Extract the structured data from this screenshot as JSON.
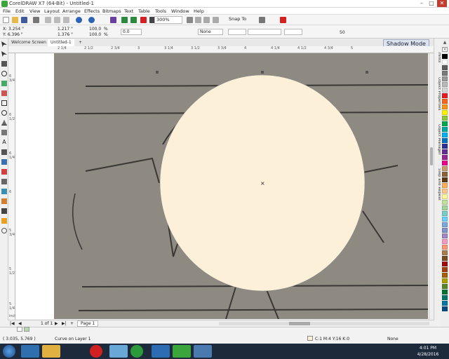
{
  "window": {
    "title": "CorelDRAW X7 (64-Bit) - Untitled-1",
    "controls": [
      "–",
      "□",
      "✕"
    ]
  },
  "menu": [
    "File",
    "Edit",
    "View",
    "Layout",
    "Arrange",
    "Effects",
    "Bitmaps",
    "Text",
    "Table",
    "Tools",
    "Window",
    "Help"
  ],
  "toolbar": {
    "zoom": "300%",
    "snap_to": "Snap To",
    "icons": [
      "new-icon",
      "open-icon",
      "save-icon",
      "print-icon",
      "cut-icon",
      "copy-icon",
      "paste-icon",
      "undo-icon",
      "redo-icon",
      "search-icon",
      "import-icon",
      "export-icon",
      "publish-icon",
      "corel-connect-icon",
      "welcome-icon",
      "full-screen-icon",
      "rulers-icon",
      "grid-icon",
      "guidelines-icon",
      "options-icon",
      "launch-icon"
    ]
  },
  "propbar": {
    "x": "X: 3.254 \"",
    "y": "Y: 6.396 \"",
    "w": "1.217 \"",
    "h": "1.376 \"",
    "sx": "100.0",
    "sy": "100.0",
    "pct1": "%",
    "pct2": "%",
    "angle": "0.0",
    "outline": "None",
    "mitter": "50"
  },
  "doctabs": {
    "welcome": "Welcome Screen",
    "doc": "Untitled-1"
  },
  "shadow_mode": "Shadow Mode",
  "ruler": {
    "h_labels": [
      "2 1/4",
      "2 1/2",
      "2 3/4",
      "3",
      "3 1/4",
      "3 1/2",
      "3 3/4",
      "4",
      "4 1/4",
      "4 1/2",
      "4 3/4",
      "5"
    ],
    "v_labels": [
      "6 3/4",
      "6 1/2",
      "6 1/4",
      "6",
      "5 3/4",
      "5 1/2",
      "5 1/4"
    ],
    "unit": "inches"
  },
  "dockers": [
    "Hints",
    "Object Properties",
    "Object Manager",
    "Step and Repeat"
  ],
  "palette": [
    "#000000",
    "#ffffff",
    "#5c5c5c",
    "#7a7a7a",
    "#999999",
    "#b8b8b8",
    "#d6d6d6",
    "#e31b23",
    "#f26522",
    "#f7941d",
    "#fff200",
    "#8dc63f",
    "#00a651",
    "#00a99d",
    "#00aeef",
    "#0072bc",
    "#2e3192",
    "#662d91",
    "#92278f",
    "#ec008c",
    "#c69c6d",
    "#8c6239",
    "#603913",
    "#fbaf5d",
    "#fdc689",
    "#fff799",
    "#c4df9b",
    "#a3d39c",
    "#7accc8",
    "#6dcff6",
    "#7da7d9",
    "#8393ca",
    "#a187be",
    "#f49ac1",
    "#f7977a",
    "#a67c52",
    "#754c24",
    "#9e0b0f",
    "#a0410d",
    "#a36209",
    "#aba000",
    "#598527",
    "#007236",
    "#00746b",
    "#0076a3",
    "#004b80"
  ],
  "pagebar": {
    "position": "1 of 1",
    "page": "Page 1"
  },
  "status": {
    "coords": "( 3.035, 5.769 )",
    "object": "Curve on Layer 1",
    "fill": "C:1 M:4 Y:16 K:0",
    "outline": "None"
  },
  "colors": {
    "ellipse_fill": "#fdf0d8",
    "accent": "#3aa53a"
  },
  "taskbar": {
    "time": "4:01 PM",
    "date": "4/28/2016",
    "apps": [
      "start-icon",
      "ie-icon",
      "explorer-icon",
      "opera-icon",
      "folder-icon",
      "chrome-icon",
      "corel-icon",
      "word-icon",
      "coreldraw-icon",
      "paint-icon"
    ]
  }
}
